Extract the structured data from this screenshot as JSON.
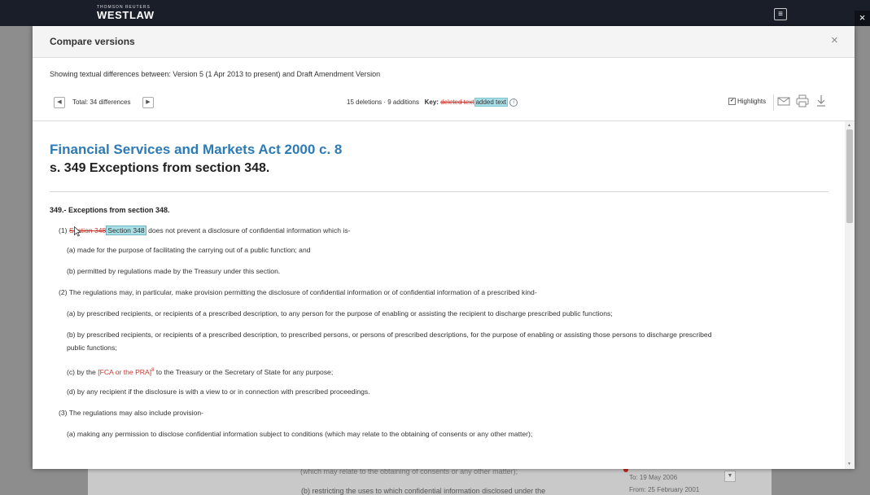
{
  "app": {
    "logo_small": "THOMSON REUTERS",
    "logo": "WESTLAW",
    "close_glyph": "×",
    "menu_icon": "hamburger-menu-icon"
  },
  "background": {
    "text1": "(which may relate to the obtaining of consents or any other matter);",
    "text2": "(b)  restricting the uses to which confidential information disclosed under the",
    "date_to": "To: 19 May 2006",
    "date_from": "From: 25 February 2001"
  },
  "modal": {
    "title": "Compare versions",
    "close_glyph": "×"
  },
  "summary": "Showing textual differences between: Version 5 (1 Apr 2013 to present) and Draft Amendment Version",
  "nav": {
    "prev_glyph": "◀",
    "next_glyph": "▶",
    "total": "Total: 34 differences"
  },
  "counts": {
    "text": "15 deletions · 9 additions",
    "key_label": "Key:",
    "key_deleted": "deleted text",
    "key_added": "added text",
    "info_glyph": "i"
  },
  "toolbar": {
    "highlights_label": "Highlights",
    "highlights_checked": true,
    "check_glyph": "✔",
    "tools": [
      "email-icon",
      "print-icon",
      "download-icon"
    ]
  },
  "document": {
    "act_title": "Financial Services and Markets Act 2000 c. 8",
    "section_title": "s. 349 Exceptions from section 348.",
    "heading": "349.- Exceptions from section 348.",
    "p1_num": "(1)",
    "p1_deleted": "Section 348",
    "p1_added": "Section 348",
    "p1_rest": " does not prevent a disclosure of confidential information which is-",
    "p1a": "(a)  made for the purpose of facilitating the carrying out of a public function; and",
    "p1b": "(b)  permitted by regulations made by the Treasury under this section.",
    "p2": "(2)  The regulations may, in particular, make provision permitting the disclosure of confidential information or of confidential information of a prescribed kind-",
    "p2a": "(a)  by prescribed recipients, or recipients of a prescribed description, to any person for the purpose of enabling or assisting the recipient to discharge prescribed public functions;",
    "p2b_line1": "(b)  by prescribed recipients, or recipients of a prescribed description, to prescribed persons, or persons of prescribed descriptions, for the purpose of enabling or assisting those persons to discharge prescribed",
    "p2b_line2": "public functions;",
    "p2c_pre": "(c)  by the ",
    "p2c_mark": "[FCA or the PRA]",
    "p2c_sup": "8",
    "p2c_post": "  to the Treasury or the Secretary of State for any purpose;",
    "p2d": "(d)  by any recipient if the disclosure is with a view to or in connection with prescribed proceedings.",
    "p3": "(3)  The regulations may also include provision-",
    "p3a": "(a)  making any permission to disclose confidential information subject to conditions (which may relate to the obtaining of consents or any other matter);"
  },
  "scrollbar": {
    "up_glyph": "▲",
    "down_glyph": "▼"
  },
  "colors": {
    "topbar": "#1a1e29",
    "title_blue": "#2c7bb5",
    "deleted_red": "#c9362d",
    "added_highlight": "#a9dfe6"
  }
}
